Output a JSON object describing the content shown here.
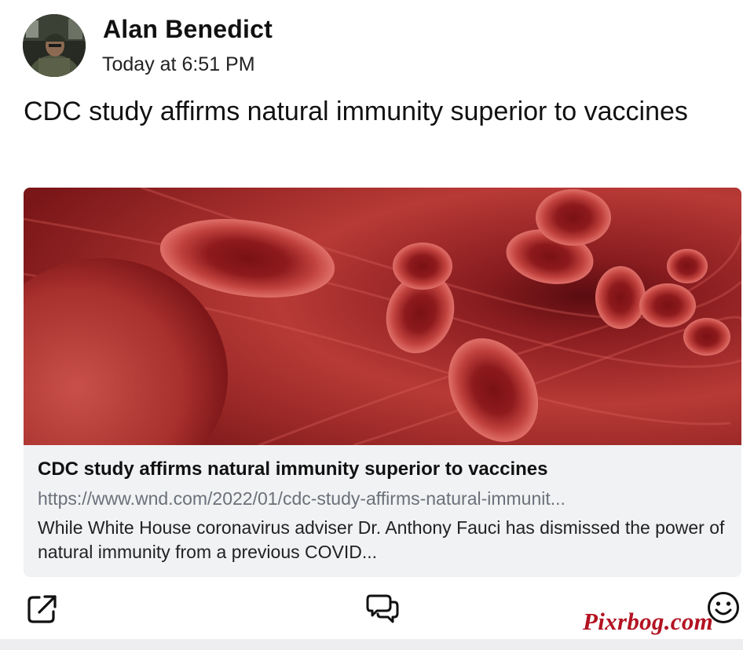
{
  "post": {
    "author": "Alan Benedict",
    "timestamp": "Today at 6:51 PM",
    "text": "CDC study affirms natural immunity superior to vaccines"
  },
  "link_preview": {
    "image_icon": "red-blood-cells-image",
    "title": "CDC study affirms natural immunity superior to vaccines",
    "url": "https://www.wnd.com/2022/01/cdc-study-affirms-natural-immunit...",
    "description": "While White House coronavirus adviser Dr. Anthony Fauci has dismissed the power of natural immunity from a previous COVID..."
  },
  "actions": {
    "share_icon": "share-icon",
    "comment_icon": "comment-icon",
    "reaction_icon": "smiley-icon"
  },
  "watermark": "Pixrbog.com",
  "colors": {
    "icon": "#111111",
    "url_text": "#6b7079",
    "link_card_bg": "#f1f2f4",
    "watermark": "#b31322"
  }
}
